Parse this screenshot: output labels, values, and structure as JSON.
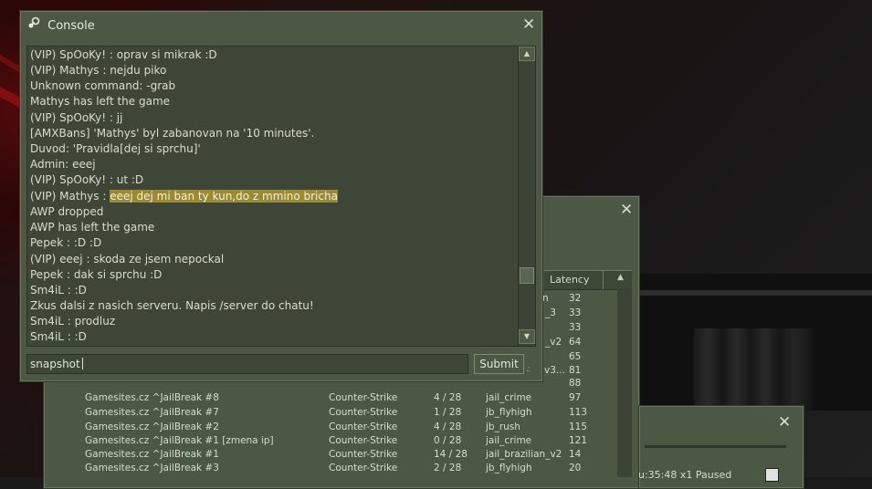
{
  "console": {
    "title": "Console",
    "lines": [
      "(VIP) SpOoKy! : oprav si mikrak :D",
      "(VIP) Mathys : nejdu piko",
      "Unknown command: -grab",
      "Mathys has left the game",
      "(VIP) SpOoKy! : jj",
      "[AMXBans] 'Mathys' byl zabanovan na '10 minutes'.",
      " Duvod: 'Pravidla[dej si sprchu]'",
      " Admin: eeej",
      "(VIP) SpOoKy! : ut :D",
      "AWP dropped",
      "AWP has left the game",
      "Pepek : :D :D",
      "(VIP) eeej : skoda ze jsem nepockal",
      "Pepek : dak si sprchu :D",
      "Sm4iL : :D",
      "Zkus dalsi z nasich serveru. Napis /server do chatu!",
      "Sm4iL : prodluz",
      "Sm4iL : :D"
    ],
    "highlight_prefix": "(VIP) Mathys : ",
    "highlight_text": "eeej dej mi ban ty kun,do z mmino bricha",
    "input_value": "snapshot",
    "submit_label": "Submit",
    "accent_highlight": "#9c8a2e"
  },
  "server_browser": {
    "column_latency": "Latency",
    "partial_cells": [
      "_3",
      "_v2",
      "v3..."
    ],
    "latency_top": [
      "32",
      "33",
      "33",
      "64",
      "65",
      "81"
    ],
    "rows": [
      {
        "name": "Gamesites.cz ^JailBreak #8",
        "game": "Counter-Strike",
        "players": "4 / 28",
        "map": "jail_crime",
        "latency": "97"
      },
      {
        "name": "Gamesites.cz ^JailBreak #7",
        "game": "Counter-Strike",
        "players": "1 / 28",
        "map": "jb_flyhigh",
        "latency": "113"
      },
      {
        "name": "Gamesites.cz ^JailBreak #2",
        "game": "Counter-Strike",
        "players": "4 / 28",
        "map": "jb_rush",
        "latency": "115"
      },
      {
        "name": "Gamesites.cz ^JailBreak #1 [zmena ip]",
        "game": "Counter-Strike",
        "players": "0 / 28",
        "map": "jail_crime",
        "latency": "121"
      },
      {
        "name": "Gamesites.cz ^JailBreak #1",
        "game": "Counter-Strike",
        "players": "14 / 28",
        "map": "jail_brazilian_v2",
        "latency": "14"
      },
      {
        "name": "Gamesites.cz ^JailBreak #3",
        "game": "Counter-Strike",
        "players": "2 / 28",
        "map": "jb_flyhigh",
        "latency": "20"
      }
    ],
    "latency_88": "88"
  },
  "demo_window": {
    "status_text": "u:35:48  x1  Paused"
  }
}
